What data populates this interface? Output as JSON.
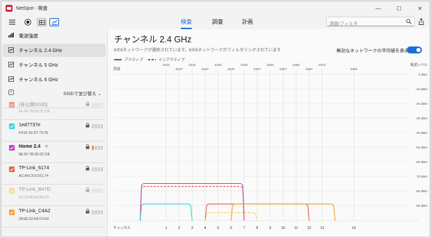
{
  "window": {
    "title": "NetSpot - 検査",
    "controls": {
      "minimize": "—",
      "maximize": "☐",
      "close": "✕"
    }
  },
  "toolbar": {
    "tabs": [
      {
        "label": "検査",
        "active": true
      },
      {
        "label": "調査",
        "active": false
      },
      {
        "label": "計画",
        "active": false
      }
    ],
    "search_placeholder": "調査/フィルタ"
  },
  "sidebar": {
    "bands": [
      {
        "label": "電波強度",
        "selected": false
      },
      {
        "label": "チャンネル 2.4 GHz",
        "selected": true
      },
      {
        "label": "チャンネル 5 GHz",
        "selected": false
      },
      {
        "label": "チャンネル 6 GHz",
        "selected": false
      }
    ],
    "sort_label": "SSIDで並び替え ⌄",
    "networks": [
      {
        "name": "[非公開SSID]",
        "mac": "8E:FF:7B:D5:3C:DE",
        "color": "#e8434a",
        "dim": true,
        "bold": false,
        "wifi": false
      },
      {
        "name": "1ed7737e",
        "mac": "F4:91:1E:D7:73:7E",
        "color": "#2fd7d7",
        "dim": false,
        "bold": false,
        "wifi": false
      },
      {
        "name": "Home 2.4",
        "mac": "8E:FF:7B:D5:3C:DE",
        "color": "#c23bd0",
        "dim": false,
        "bold": true,
        "wifi": true
      },
      {
        "name": "TP-Link_6174",
        "mac": "AC:84:C6:F3:61:74",
        "color": "#e8604a",
        "dim": false,
        "bold": false,
        "wifi": false
      },
      {
        "name": "TP-Link_B47D",
        "mac": "50:C4:4B:A4:B4:7D",
        "color": "#f3c94a",
        "dim": true,
        "bold": false,
        "wifi": false
      },
      {
        "name": "TP-Link_C4A2",
        "mac": "28:EE:52:FA:C4:A2",
        "color": "#f0a030",
        "dim": false,
        "bold": false,
        "wifi": false
      }
    ]
  },
  "main": {
    "title": "チャンネル 2.4 GHz",
    "subtitle": "6の6ネットワークが選択されています。6の6ネットワークがフィルタリングされています",
    "toggle_label": "無効なネットワークの平均値を表示",
    "legend": {
      "active": "アクティブ",
      "inactive": "インアクティブ"
    }
  },
  "chart_data": {
    "type": "area",
    "freq_label": "周波",
    "channel_label": "チャンネル",
    "level_label": "電波レベル",
    "freqs_top": [
      "2412",
      "2422",
      "2432",
      "2442",
      "2452",
      "2462",
      "2472"
    ],
    "freqs_bottom": [
      "2417",
      "2427",
      "2437",
      "2447",
      "2457",
      "2467"
    ],
    "freq_extra": "2484",
    "channels": [
      "1",
      "2",
      "3",
      "4",
      "5",
      "6",
      "7",
      "8",
      "9",
      "10",
      "11",
      "12",
      "13",
      "14"
    ],
    "levels": [
      "0 dBm",
      "-10 dBm",
      "-20 dBm",
      "-30 dBm",
      "-40 dBm",
      "-50 dBm",
      "-60 dBm",
      "-70 dBm",
      "-80 dBm",
      "-90 dBm"
    ],
    "ylim": [
      -100,
      0
    ],
    "series": [
      {
        "name": "Home 2.4",
        "center": 3,
        "width_channels": 8,
        "level": -75,
        "active": true,
        "color": "#c23bd0"
      },
      {
        "name": "[非公開SSID]",
        "center": 3,
        "width_channels": 8,
        "level": -77,
        "active": false,
        "color": "#e8434a"
      },
      {
        "name": "1ed7737e",
        "center": 1,
        "width_channels": 4,
        "level": -89,
        "active": true,
        "color": "#2fd7d7"
      },
      {
        "name": "TP-Link_6174",
        "center": 8,
        "width_channels": 8,
        "level": -89,
        "active": true,
        "color": "#e8604a"
      },
      {
        "name": "TP-Link_C4A2",
        "center": 10,
        "width_channels": 8,
        "level": -89,
        "active": true,
        "color": "#f0a030"
      },
      {
        "name": "TP-Link_B47D",
        "center": 6,
        "width_channels": 4,
        "level": -95,
        "active": false,
        "color": "#f3c94a"
      }
    ]
  }
}
